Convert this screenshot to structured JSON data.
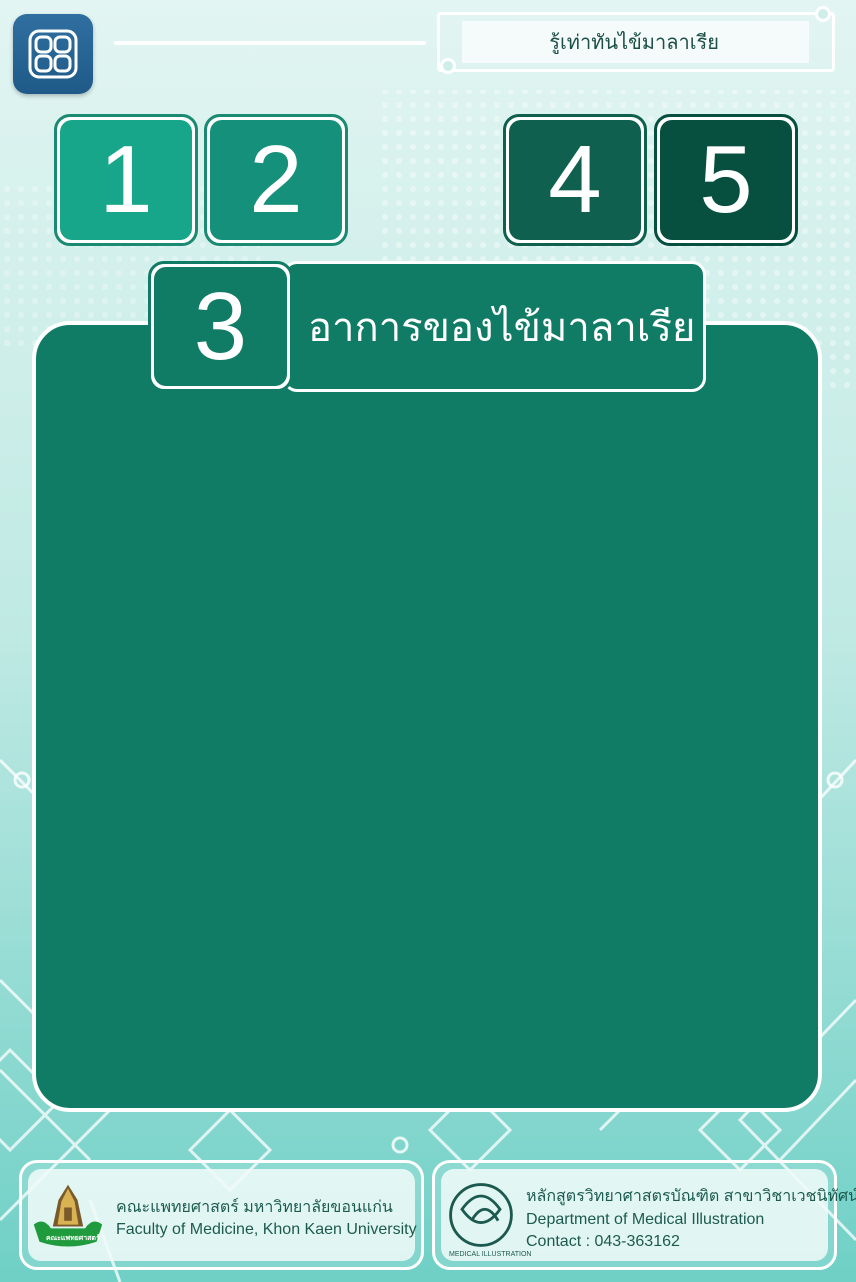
{
  "header": {
    "menu_icon": "grid-menu-icon",
    "title": "รู้เท่าทันไข้มาลาเรีย"
  },
  "chapters": [
    {
      "label": "1",
      "color": "#17a68a"
    },
    {
      "label": "2",
      "color": "#15907a"
    },
    {
      "label": "3",
      "color": "#117c66"
    },
    {
      "label": "4",
      "color": "#0f604f"
    },
    {
      "label": "5",
      "color": "#075040"
    }
  ],
  "active_section": {
    "number": "3",
    "title": "อาการของไข้มาลาเรีย"
  },
  "footer": {
    "left": {
      "logo_icon": "faculty-seal-icon",
      "logo_text": "คณะแพทยศาสตร์",
      "line1": "คณะแพทยศาสตร์ มหาวิทยาลัยขอนแก่น",
      "line2": "Faculty of Medicine, Khon Kaen University"
    },
    "right": {
      "logo_icon": "medical-illustration-logo-icon",
      "logo_text": "MEDICAL ILLUSTRATION",
      "line1": "หลักสูตรวิทยาศาสตรบัณฑิต สาขาวิชาเวชนิทัศน์",
      "line2": "Department of Medical Illustration",
      "line3": "Contact : 043-363162"
    }
  }
}
